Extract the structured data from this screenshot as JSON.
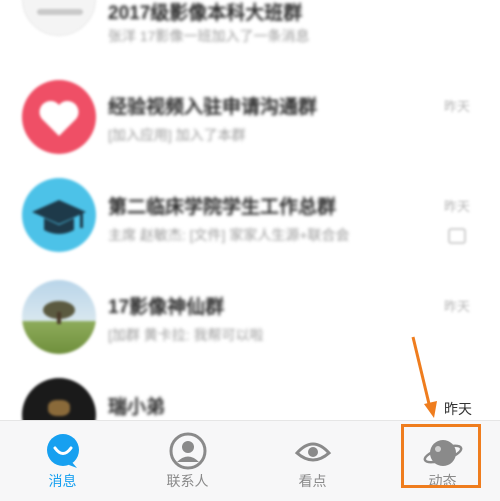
{
  "conversations": [
    {
      "title": "2017级影像本科大班群",
      "subtitle": "张洋 17影像一班加入了一条消息",
      "time": ""
    },
    {
      "title": "经验视频入驻申请沟通群",
      "subtitle": "[加入应用] 加入了本群",
      "time": "昨天"
    },
    {
      "title": "第二临床学院学生工作总群",
      "subtitle": "主席 赵敏杰: [文件] 家家人生源+联合会",
      "time": "昨天"
    },
    {
      "title": "17影像神仙群",
      "subtitle": "[加群 黄卡拉: 我帮可以啦",
      "time": "昨天"
    },
    {
      "title": "瑞小弟",
      "subtitle": "",
      "time": ""
    }
  ],
  "annotation": {
    "time_label": "昨天"
  },
  "tabs": [
    {
      "label": "消息",
      "icon": "message-icon",
      "active": true
    },
    {
      "label": "联系人",
      "icon": "contacts-icon",
      "active": false
    },
    {
      "label": "看点",
      "icon": "eye-icon",
      "active": false
    },
    {
      "label": "动态",
      "icon": "planet-icon",
      "active": false
    }
  ],
  "colors": {
    "accent": "#17a0f0",
    "highlight": "#ef7d1e",
    "heart_bg": "#ef4f66"
  }
}
